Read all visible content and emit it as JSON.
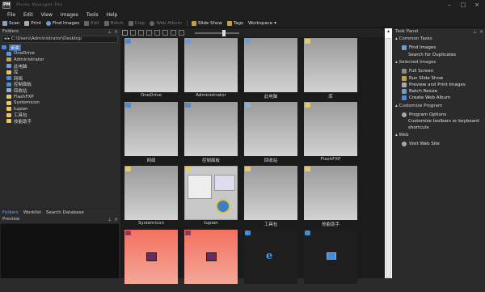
{
  "app": {
    "logo": "PM",
    "title": "Photo Manager Pro"
  },
  "window_controls": {
    "minimize": "–",
    "maximize": "□",
    "close": "×"
  },
  "menu": [
    "File",
    "Edit",
    "View",
    "Images",
    "Tools",
    "Help"
  ],
  "toolbar": {
    "scan": "Scan",
    "print": "Print",
    "find": "Find Images",
    "edit": "Edit",
    "batch": "Batch",
    "crop": "Crop",
    "web_album": "Web Album",
    "slideshow": "Slide Show",
    "tags": "Tags",
    "workspace": "Workspace"
  },
  "folders": {
    "title": "Folders",
    "path": "C:\\Users\\Administrator\\Desktop",
    "tree": [
      "桌面",
      "OneDrive",
      "Administrator",
      "此电脑",
      "库",
      "网络",
      "控制面板",
      "回收站",
      "FlashFXP",
      "Systemicon",
      "tupian",
      "工具包",
      "技能助手"
    ]
  },
  "bottom_tabs": [
    "Folders",
    "Worklist",
    "Search Database"
  ],
  "preview": {
    "title": "Preview"
  },
  "thumbnails": [
    "OneDrive",
    "Administrator",
    "此电脑",
    "库",
    "网络",
    "控制面板",
    "回收站",
    "FlashFXP",
    "Systemicon",
    "tupian",
    "工具包",
    "技能助手",
    "",
    "",
    "",
    ""
  ],
  "task_panel": {
    "title": "Task Panel",
    "common_tasks": {
      "header": "Common Tasks",
      "find_images": "Find Images",
      "search_duplicates": "Search for Duplicates"
    },
    "selected_images": {
      "header": "Selected Images",
      "full_screen": "Full Screen",
      "run_slideshow": "Run Slide Show",
      "preview_print": "Preview and Print Images",
      "batch_resize": "Batch Resize",
      "create_web_album": "Create Web Album"
    },
    "customize": {
      "header": "Customize Program",
      "options": "Program Options",
      "toolbars_line1": "Customize toolbars or keyboard",
      "toolbars_line2": "shortcuts"
    },
    "web": {
      "header": "Web",
      "visit": "Visit Web Site"
    }
  },
  "colors": {
    "accent": "#3d6fb6",
    "folder": "#e8c860",
    "active_tab": "#5aa0ff"
  }
}
